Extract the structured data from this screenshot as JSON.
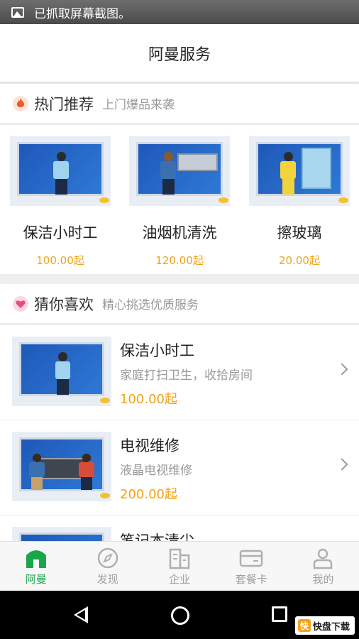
{
  "status_bar": {
    "notification": "已抓取屏幕截图。",
    "icon": "image-icon"
  },
  "title_bar": {
    "title": "阿曼服务"
  },
  "hot_section": {
    "title": "热门推荐",
    "subtitle": "上门爆品来袭",
    "icon": "fire-icon",
    "items": [
      {
        "name": "保洁小时工",
        "price": "100.00起"
      },
      {
        "name": "油烟机清洗",
        "price": "120.00起"
      },
      {
        "name": "擦玻璃",
        "price": "20.00起"
      }
    ]
  },
  "guess_section": {
    "title": "猜你喜欢",
    "subtitle": "精心挑选优质服务",
    "icon": "heart-icon",
    "items": [
      {
        "title": "保洁小时工",
        "desc": "家庭打扫卫生，收拾房间",
        "price": "100.00起"
      },
      {
        "title": "电视维修",
        "desc": "液晶电视维修",
        "price": "200.00起"
      },
      {
        "title": "笔记本清尘",
        "desc": "",
        "price": ""
      }
    ]
  },
  "tab_bar": {
    "tabs": [
      {
        "label": "阿曼",
        "icon": "home-icon",
        "active": true
      },
      {
        "label": "发现",
        "icon": "compass-icon",
        "active": false
      },
      {
        "label": "企业",
        "icon": "building-icon",
        "active": false
      },
      {
        "label": "套餐卡",
        "icon": "card-icon",
        "active": false
      },
      {
        "label": "我的",
        "icon": "person-icon",
        "active": false
      }
    ]
  },
  "watermark": {
    "text": "快盘下载",
    "logo": "快"
  },
  "colors": {
    "accent": "#1aa64a",
    "price": "#f0a21b",
    "thumb_blue": "#2a6cc9"
  }
}
